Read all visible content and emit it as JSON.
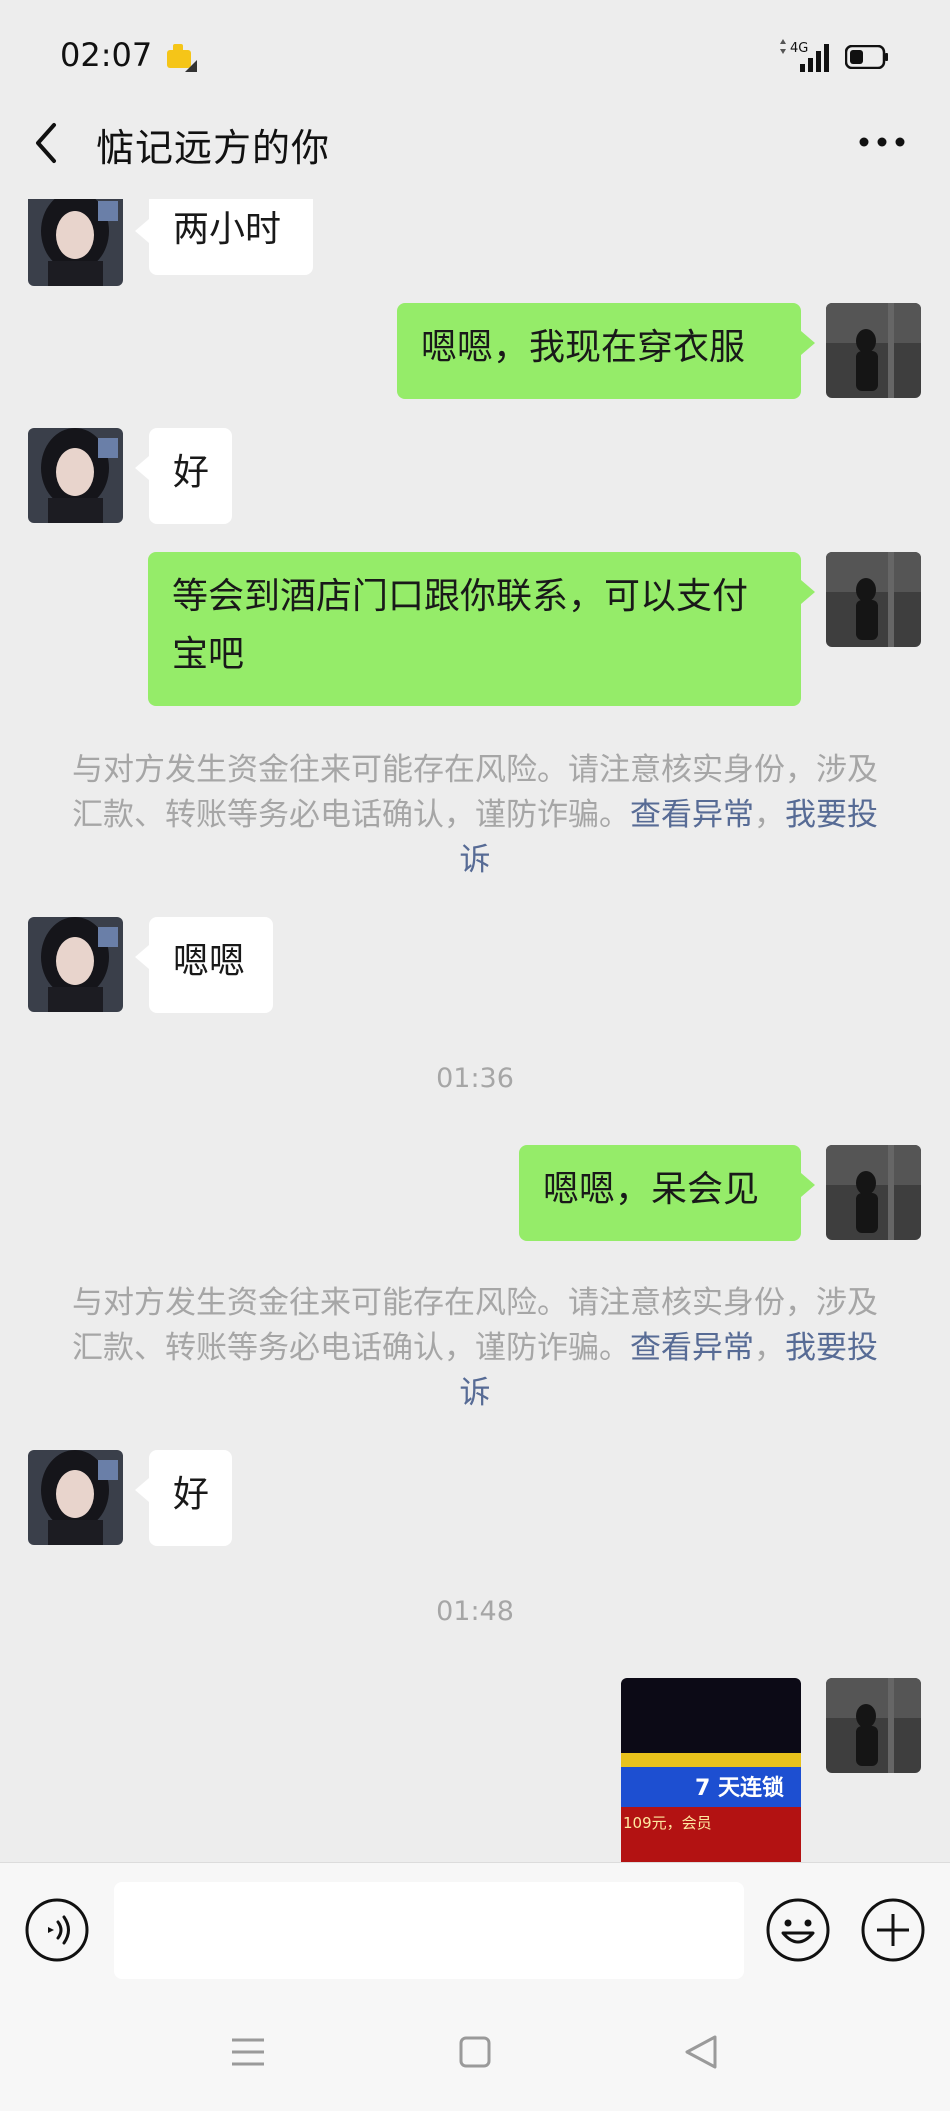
{
  "status_bar": {
    "time": "02:07",
    "network": "4G"
  },
  "header": {
    "title": "惦记远方的你"
  },
  "messages": [
    {
      "side": "in",
      "text": "两小时"
    },
    {
      "side": "out",
      "text": "嗯嗯，我现在穿衣服"
    },
    {
      "side": "in",
      "text": "好"
    },
    {
      "side": "out",
      "text": "等会到酒店门口跟你联系，可以支付宝吧"
    },
    {
      "side": "in",
      "text": "嗯嗯"
    },
    {
      "side": "out",
      "text": "嗯嗯，呆会见"
    },
    {
      "side": "in",
      "text": "好"
    }
  ],
  "system_notices": [
    {
      "text": "与对方发生资金往来可能存在风险。请注意核实身份，涉及汇款、转账等务必电话确认，谨防诈骗。",
      "link_view": "查看异常",
      "separator": "，",
      "link_report": "我要投诉"
    },
    {
      "text": "与对方发生资金往来可能存在风险。请注意核实身份，涉及汇款、转账等务必电话确认，谨防诈骗。",
      "link_view": "查看异常",
      "separator": "，",
      "link_report": "我要投诉"
    }
  ],
  "timestamps": [
    "01:36",
    "01:48"
  ],
  "photo_message": {
    "sign_text": "7 天连锁",
    "price_text": "109元，会员"
  },
  "colors": {
    "background": "#ededed",
    "outgoing_bubble": "#95ec69",
    "incoming_bubble": "#ffffff",
    "link": "#576b95",
    "system_text": "#a6a6a6"
  },
  "icons": {
    "back": "back-arrow-icon",
    "more": "more-dots-icon",
    "voice": "voice-icon",
    "emoji": "emoji-icon",
    "plus": "plus-icon"
  }
}
